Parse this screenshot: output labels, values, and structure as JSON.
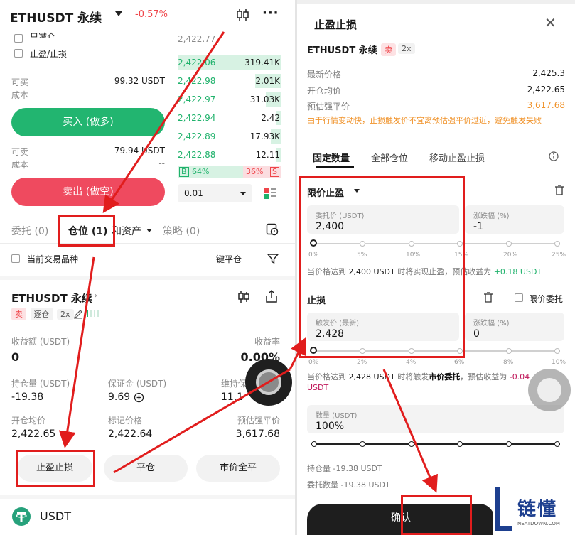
{
  "left": {
    "header": {
      "pair": "ETHUSDT 永续",
      "change": "-0.57%"
    },
    "options": {
      "hidden_top": "只减仓",
      "tp_sl": "止盈/止损"
    },
    "buy": {
      "avail_label": "可买",
      "avail_value": "99.32 USDT",
      "cost_label": "成本",
      "cost_value": "--",
      "button": "买入 (做多)"
    },
    "sell": {
      "avail_label": "可卖",
      "avail_value": "79.94 USDT",
      "cost_label": "成本",
      "cost_value": "--",
      "button": "卖出 (做空)"
    },
    "orderbook": {
      "top_price": "2,422.77",
      "rows": [
        {
          "price": "2,422.06",
          "qty": "319.41K",
          "fill": 1.0
        },
        {
          "price": "2,422.98",
          "qty": "2.01K",
          "fill": 0.25
        },
        {
          "price": "2,422.97",
          "qty": "31.03K",
          "fill": 0.15
        },
        {
          "price": "2,422.94",
          "qty": "2.42",
          "fill": 0.02
        },
        {
          "price": "2,422.89",
          "qty": "17.93K",
          "fill": 0.1
        },
        {
          "price": "2,422.88",
          "qty": "12.11",
          "fill": 0.02
        }
      ],
      "buy_badge": "B",
      "buy_pct": "64%",
      "sell_pct": "36%",
      "sell_badge": "S",
      "depth": "0.01"
    },
    "tabs": {
      "orders": "委托 (0)",
      "positions": "仓位 (1)",
      "assets": "和资产",
      "strategy": "策略 (0)"
    },
    "filter": {
      "current_label": "当前交易品种",
      "close_all": "一键平仓"
    },
    "position": {
      "symbol": "ETHUSDT 永续",
      "side": "卖",
      "mode": "逐仓",
      "leverage": "2x",
      "pnl_label": "收益额 (USDT)",
      "pnl_value": "0",
      "roi_label": "收益率",
      "roi_value": "0.00%",
      "size_label": "持仓量 (USDT)",
      "size_value": "-19.38",
      "margin_label": "保证金 (USDT)",
      "margin_value": "9.69",
      "maint_label": "维持保",
      "maint_value": "11.1",
      "entry_label": "开仓均价",
      "entry_value": "2,422.65",
      "mark_label": "标记价格",
      "mark_value": "2,422.64",
      "liq_label": "预估强平价",
      "liq_value": "3,617.68"
    },
    "actions": {
      "tpsl": "止盈止损",
      "close": "平仓",
      "market_close": "市价全平"
    },
    "bottom_asset": "USDT"
  },
  "modal": {
    "title": "止盈止损",
    "pair": "ETHUSDT 永续",
    "side": "卖",
    "leverage": "2x",
    "latest_label": "最新价格",
    "latest_value": "2,425.3",
    "entry_label": "开仓均价",
    "entry_value": "2,422.65",
    "liq_label": "预估强平价",
    "liq_value": "3,617.68",
    "warning": "由于行情变动快，止损触发价不宜离预估强平价过近，避免触发失败",
    "tabs": {
      "fixed": "固定数量",
      "all": "全部仓位",
      "trailing": "移动止盈止损"
    },
    "tp": {
      "title": "限价止盈",
      "price_label": "委托价 (USDT)",
      "price_value": "2,400",
      "pct_label": "涨跌幅 (%)",
      "pct_value": "-1",
      "ticks": [
        "0%",
        "5%",
        "10%",
        "15%",
        "20%",
        "25%"
      ],
      "note_a": "当价格达到",
      "note_price": "2,400 USDT",
      "note_b": "时将实现止盈，预估收益为",
      "note_gain": "+0.18 USDT"
    },
    "sl": {
      "title": "止损",
      "limit_label": "限价委托",
      "price_label": "触发价 (最新)",
      "price_value": "2,428",
      "pct_label": "涨跌幅 (%)",
      "pct_value": "0",
      "ticks": [
        "0%",
        "2%",
        "4%",
        "6%",
        "8%",
        "10%"
      ],
      "note_a": "当价格达到",
      "note_price": "2,428 USDT",
      "note_b": "时将触发",
      "note_type": "市价委托",
      "note_c": "，预估收益为",
      "note_loss": "-0.04 USDT"
    },
    "qty": {
      "label": "数量 (USDT)",
      "value": "100%"
    },
    "summary": {
      "hold": "持仓量 -19.38 USDT",
      "order": "委托数量 -19.38 USDT"
    },
    "confirm": "确认"
  },
  "watermark": {
    "brand": "链懂",
    "domain": "NEATDOWN.COM"
  }
}
